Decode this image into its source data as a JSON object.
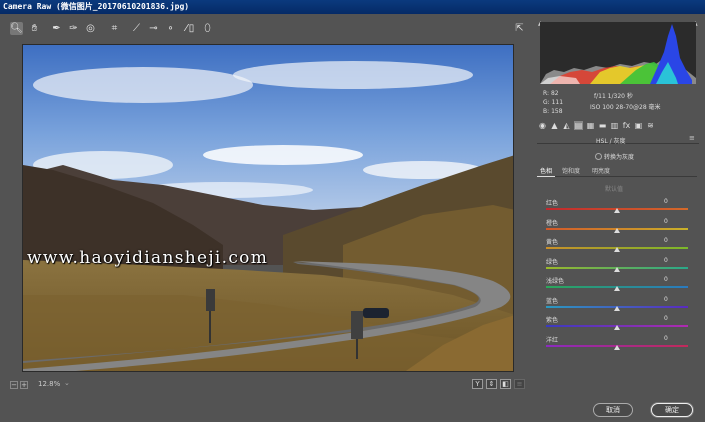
{
  "window": {
    "title": "Camera Raw (微信图片_20170610201836.jpg)"
  },
  "toolbar": {
    "tools": [
      {
        "name": "zoom-tool",
        "glyph": "🔍︎"
      },
      {
        "name": "hand-tool",
        "glyph": "✋︎"
      },
      {
        "name": "white-balance-tool",
        "glyph": "✒"
      },
      {
        "name": "color-sampler-tool",
        "glyph": "✑"
      },
      {
        "name": "targeted-adjustment-tool",
        "glyph": "◎"
      },
      {
        "name": "crop-tool",
        "glyph": "⌗"
      },
      {
        "name": "straighten-tool",
        "glyph": "⟋"
      },
      {
        "name": "spot-removal-tool",
        "glyph": "⊸"
      },
      {
        "name": "red-eye-tool",
        "glyph": "∘"
      },
      {
        "name": "adjustment-brush-tool",
        "glyph": "⁄"
      },
      {
        "name": "graduated-filter-tool",
        "glyph": "▯"
      },
      {
        "name": "radial-filter-tool",
        "glyph": "⬯"
      }
    ],
    "open_glyph": "⇱"
  },
  "image": {
    "watermark": "www.haoyidiansheji.com"
  },
  "bottom": {
    "zoom_out": "−",
    "zoom_in": "+",
    "zoom_level": "12.8%",
    "zoom_caret": "⌄",
    "view_buttons": [
      "Y",
      "⇕",
      "◧",
      "≡"
    ]
  },
  "info": {
    "r_label": "R:",
    "r_value": "82",
    "g_label": "G:",
    "g_value": "111",
    "b_label": "B:",
    "b_value": "158",
    "exif_line1": "f/11   1/320 秒",
    "exif_line2": "ISO 100   28-70@28 毫米"
  },
  "panel": {
    "tab_icons": [
      "◉",
      "▲",
      "◭",
      "▤",
      "▦",
      "▬",
      "▥",
      "fx",
      "▣",
      "≋"
    ],
    "section_title": "HSL / 灰度",
    "section_menu": "≡",
    "grayscale_label": "转换为灰度",
    "subtabs": [
      "色相",
      "饱和度",
      "明亮度"
    ],
    "subsection_title": "默认值",
    "sliders": [
      {
        "label": "红色",
        "value": "0",
        "colors": [
          "#c2272d",
          "#d46a2a"
        ]
      },
      {
        "label": "橙色",
        "value": "0",
        "colors": [
          "#d3582a",
          "#c9b22a"
        ]
      },
      {
        "label": "黄色",
        "value": "0",
        "colors": [
          "#c9902a",
          "#7bb82a"
        ]
      },
      {
        "label": "绿色",
        "value": "0",
        "colors": [
          "#9bb82a",
          "#2aa88a"
        ]
      },
      {
        "label": "浅绿色",
        "value": "0",
        "colors": [
          "#2aa85a",
          "#2a7ac0"
        ]
      },
      {
        "label": "蓝色",
        "value": "0",
        "colors": [
          "#2a9ac0",
          "#5a2ac0"
        ]
      },
      {
        "label": "紫色",
        "value": "0",
        "colors": [
          "#3a3ac0",
          "#b02ab0"
        ]
      },
      {
        "label": "洋红",
        "value": "0",
        "colors": [
          "#8a2ac0",
          "#c22a5a"
        ]
      }
    ]
  },
  "buttons": {
    "cancel": "取消",
    "ok": "确定"
  }
}
